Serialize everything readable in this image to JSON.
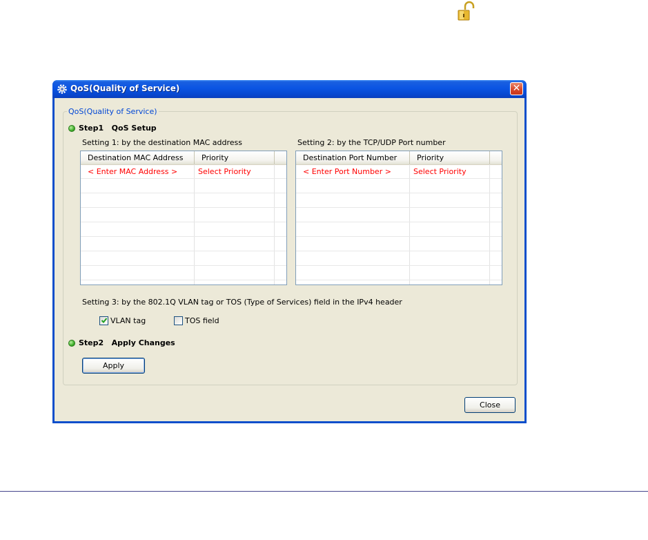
{
  "dialog": {
    "title": "QoS(Quality of Service)",
    "close_symbol": "✕",
    "group_legend": "QoS(Quality of Service)",
    "step1": {
      "label": "Step1   QoS Setup"
    },
    "setting1_label": "Setting 1: by the destination MAC address",
    "setting2_label": "Setting 2: by the TCP/UDP Port number",
    "mac_table": {
      "columns": [
        "Destination MAC Address",
        "Priority"
      ],
      "rows": [
        [
          "< Enter MAC Address >",
          "Select Priority"
        ]
      ]
    },
    "port_table": {
      "columns": [
        "Destination Port Number",
        "Priority"
      ],
      "rows": [
        [
          "< Enter Port Number >",
          "Select Priority"
        ]
      ]
    },
    "setting3_label": "Setting 3: by the 802.1Q VLAN tag or TOS (Type of Services) field in the IPv4 header",
    "vlan_checkbox": {
      "label": "VLAN tag",
      "checked": true
    },
    "tos_checkbox": {
      "label": "TOS field",
      "checked": false
    },
    "step2": {
      "label": "Step2   Apply Changes"
    },
    "apply_button": "Apply",
    "close_button": "Close"
  },
  "icons": {
    "top_lock": "unlocked-padlock-icon",
    "title": "gear-icon",
    "step_status": "green-dot-icon"
  },
  "colors": {
    "title_bar": "#0b55e3",
    "dialog_bg": "#ece9d8",
    "legend_text": "#0046d5",
    "placeholder_text": "#ff0000",
    "step_dot": "#3fae2a"
  }
}
